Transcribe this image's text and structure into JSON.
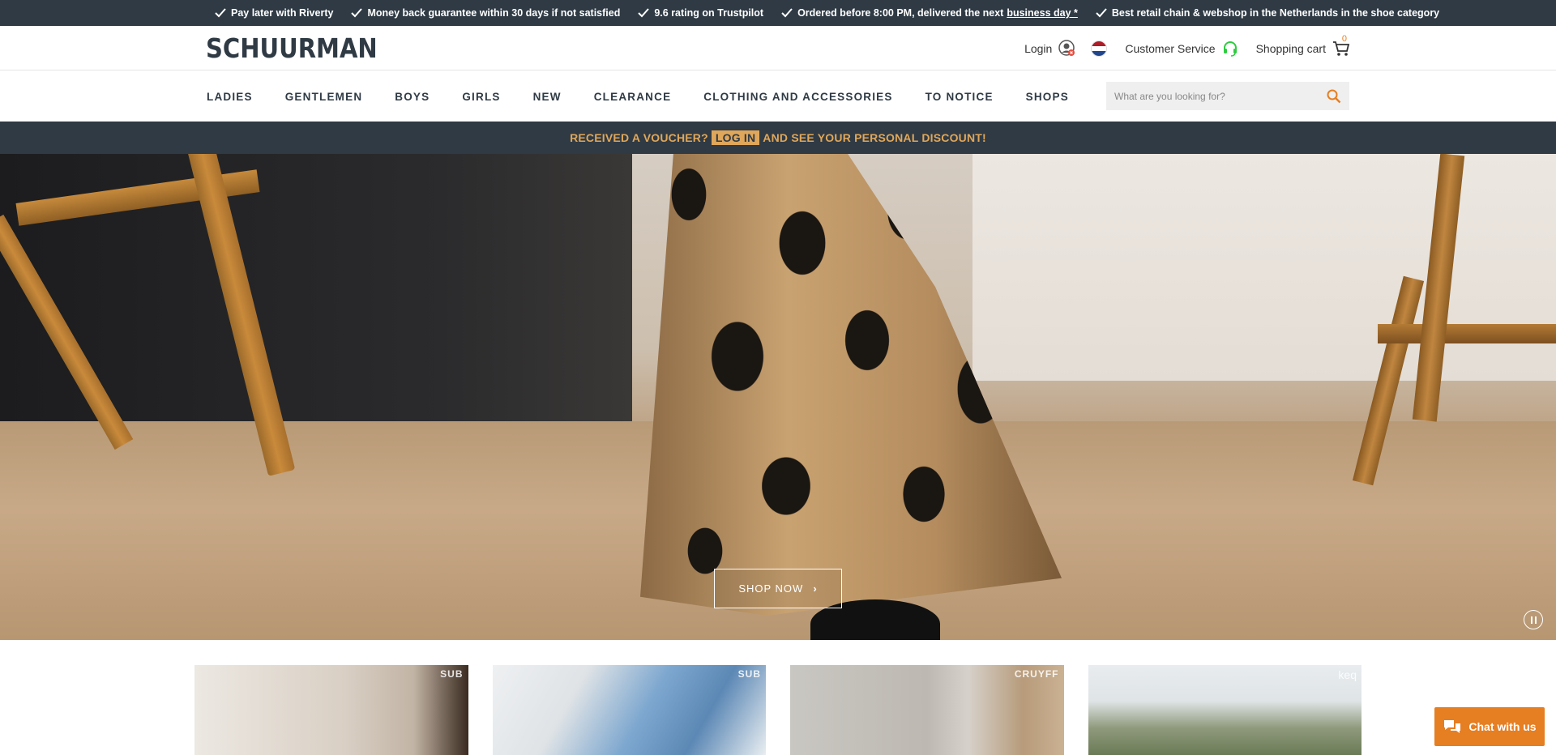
{
  "usp_bar": {
    "items": [
      {
        "text": "Pay later with Riverty"
      },
      {
        "text": "Money back guarantee within 30 days if not satisfied"
      },
      {
        "text": "9.6 rating on Trustpilot"
      },
      {
        "text": "Ordered before 8:00 PM, delivered the next",
        "link": "business day *"
      },
      {
        "text": "Best retail chain & webshop in the Netherlands in the shoe category"
      }
    ]
  },
  "header": {
    "logo": "SCHUURMAN",
    "login_label": "Login",
    "customer_service_label": "Customer Service",
    "cart_label": "Shopping cart",
    "cart_count": "0"
  },
  "nav": {
    "items": [
      "LADIES",
      "GENTLEMEN",
      "BOYS",
      "GIRLS",
      "NEW",
      "CLEARANCE",
      "CLOTHING AND ACCESSORIES",
      "TO NOTICE",
      "SHOPS"
    ],
    "search_placeholder": "What are you looking for?"
  },
  "voucher": {
    "before": "RECEIVED A VOUCHER?",
    "login": "LOG IN",
    "after": "AND SEE YOUR PERSONAL DISCOUNT!"
  },
  "hero": {
    "cta_label": "SHOP NOW"
  },
  "tiles": [
    {
      "brand": "SUB"
    },
    {
      "brand": "SUB"
    },
    {
      "brand": "CRUYFF"
    },
    {
      "brand": "keq"
    }
  ],
  "chat": {
    "label": "Chat with us"
  },
  "colors": {
    "dark_bar": "#2f3a44",
    "accent_orange": "#e67e22",
    "voucher_gold": "#e0a75a"
  }
}
